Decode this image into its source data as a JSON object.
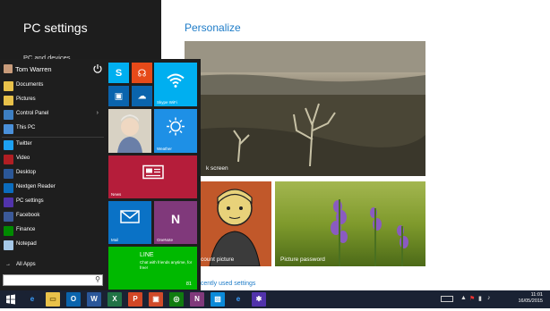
{
  "pc_settings": {
    "title": "PC settings",
    "item": "PC and devices"
  },
  "content": {
    "heading": "Personalize",
    "lock_screen_label": "k screen",
    "account_picture_label": "count picture",
    "picture_password_label": "Picture password",
    "recent_link": "ecently used settings"
  },
  "start_menu": {
    "user_name": "Tom Warren",
    "items": [
      {
        "label": "Documents",
        "icon": "folder-icon",
        "color": "#e8c14a"
      },
      {
        "label": "Pictures",
        "icon": "pictures-icon",
        "color": "#e8c14a"
      },
      {
        "label": "Control Panel",
        "icon": "control-panel-icon",
        "color": "#3d7fc2",
        "arrow": "›"
      },
      {
        "label": "This PC",
        "icon": "computer-icon",
        "color": "#4a90d9"
      },
      {
        "label": "Twitter",
        "icon": "twitter-icon",
        "color": "#1da1f2"
      },
      {
        "label": "Video",
        "icon": "video-icon",
        "color": "#b01e23"
      },
      {
        "label": "Desktop",
        "icon": "desktop-icon",
        "color": "#2b5797"
      },
      {
        "label": "Nextgen Reader",
        "icon": "reader-icon",
        "color": "#0b6cbd"
      },
      {
        "label": "PC settings",
        "icon": "gear-icon",
        "color": "#5133ab"
      },
      {
        "label": "Facebook",
        "icon": "facebook-icon",
        "color": "#3b5998"
      },
      {
        "label": "Finance",
        "icon": "finance-icon",
        "color": "#008a00"
      },
      {
        "label": "Notepad",
        "icon": "notepad-icon",
        "color": "#a5c8e8"
      }
    ],
    "all_apps": "All Apps",
    "search_icon": "search-icon"
  },
  "tiles": {
    "skype_wifi": "Skype WiFi",
    "weather": "Weather",
    "news": "News",
    "mail": "Mail",
    "onenote": "OneNote",
    "line_title": "LINE",
    "line_text": "Chat with friends anytime, for free!",
    "line_badge": "81"
  },
  "taskbar": {
    "time": "11:01",
    "date": "16/05/2015",
    "apps": [
      {
        "icon": "ie-icon",
        "color": "#1a2233",
        "glyph": "e",
        "fg": "#3aa0ff"
      },
      {
        "icon": "file-explorer-icon",
        "color": "#e8c14a",
        "glyph": "▭",
        "fg": "#7a5d10"
      },
      {
        "icon": "outlook-icon",
        "color": "#0a64ad",
        "glyph": "O"
      },
      {
        "icon": "word-icon",
        "color": "#2b579a",
        "glyph": "W"
      },
      {
        "icon": "excel-icon",
        "color": "#217346",
        "glyph": "X"
      },
      {
        "icon": "powerpoint-icon",
        "color": "#d24726",
        "glyph": "P"
      },
      {
        "icon": "store-icon",
        "color": "#d04a2a",
        "glyph": "▣"
      },
      {
        "icon": "xbox-icon",
        "color": "#107c10",
        "glyph": "◎"
      },
      {
        "icon": "onenote-icon",
        "color": "#80397b",
        "glyph": "N"
      },
      {
        "icon": "photos-icon",
        "color": "#0b8ad9",
        "glyph": "▨"
      },
      {
        "icon": "ie-icon-2",
        "color": "#1a2233",
        "glyph": "e",
        "fg": "#3aa0ff"
      },
      {
        "icon": "settings-icon",
        "color": "#5133ab",
        "glyph": "✱"
      }
    ]
  }
}
